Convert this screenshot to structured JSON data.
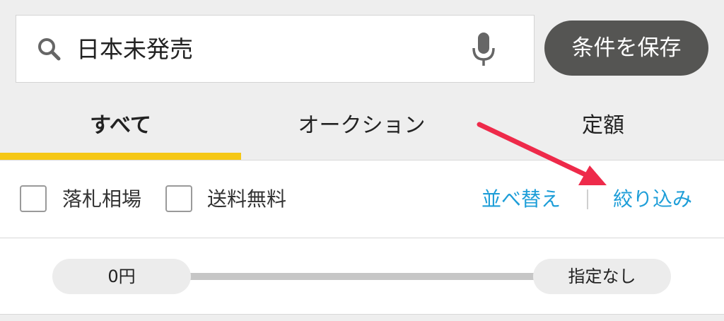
{
  "search": {
    "query": "日本未発売",
    "save_label": "条件を保存"
  },
  "tabs": [
    {
      "label": "すべて",
      "active": true
    },
    {
      "label": "オークション",
      "active": false
    },
    {
      "label": "定額",
      "active": false
    }
  ],
  "filters": {
    "checkboxes": [
      {
        "label": "落札相場",
        "checked": false
      },
      {
        "label": "送料無料",
        "checked": false
      }
    ],
    "sort_label": "並べ替え",
    "refine_label": "絞り込み"
  },
  "price_range": {
    "min_label": "0円",
    "max_label": "指定なし"
  },
  "colors": {
    "accent_yellow": "#f5c716",
    "link_blue": "#1e9ed8",
    "save_button_bg": "#555553",
    "annotation_arrow": "#ee2a4a"
  },
  "icons": {
    "search": "search-icon",
    "mic": "mic-icon",
    "annotation": "arrow-annotation"
  }
}
